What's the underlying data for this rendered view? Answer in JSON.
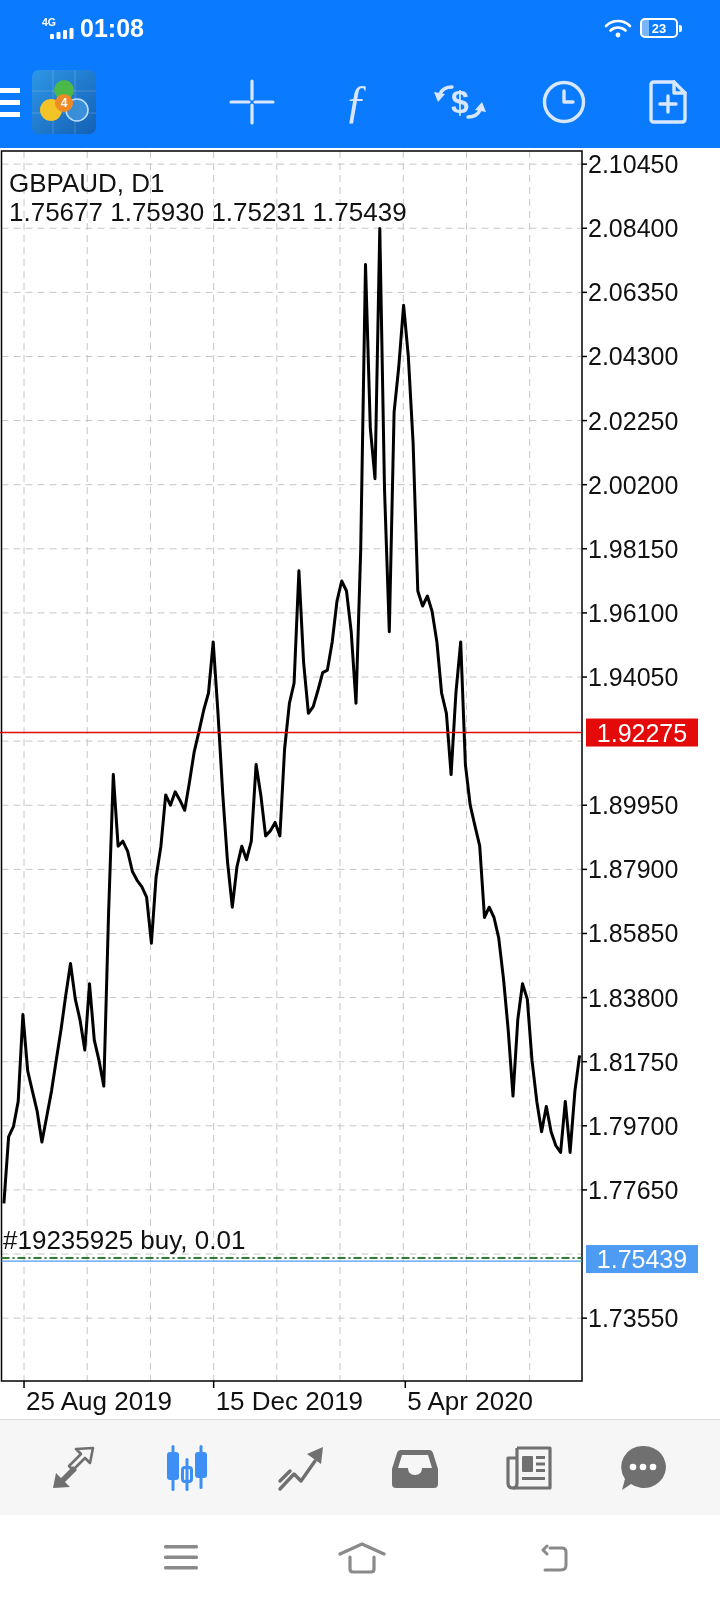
{
  "status_bar": {
    "network": "4G",
    "time": "01:08",
    "battery": "23"
  },
  "toolbar": {
    "logo_badge": "4",
    "items": [
      {
        "kind": "crosshair"
      },
      {
        "kind": "indicators",
        "glyph": "ƒ"
      },
      {
        "kind": "trade",
        "glyph": "$"
      },
      {
        "kind": "period"
      },
      {
        "kind": "objects"
      }
    ]
  },
  "chart": {
    "ohlc": "1.75677 1.75930 1.75231 1.75439",
    "chart_data": {
      "type": "line",
      "title": "GBPAUD, D1",
      "grid": true,
      "categories": [
        null,
        null,
        null,
        null,
        null,
        null,
        null,
        null,
        null,
        null,
        null,
        null,
        null,
        null,
        null,
        null,
        null,
        null,
        null,
        null,
        "25 Aug 2019",
        null,
        null,
        null,
        null,
        null,
        null,
        null,
        null,
        null,
        null,
        null,
        null,
        null,
        null,
        null,
        null,
        null,
        null,
        null,
        null,
        null,
        null,
        null,
        null,
        null,
        null,
        null,
        null,
        null,
        null,
        null,
        null,
        null,
        null,
        null,
        null,
        null,
        null,
        null,
        "15 Dec 2019",
        null,
        null,
        null,
        null,
        null,
        null,
        null,
        null,
        null,
        null,
        null,
        null,
        null,
        null,
        null,
        null,
        null,
        null,
        null,
        null,
        null,
        null,
        null,
        null,
        null,
        null,
        null,
        null,
        null,
        null,
        null,
        null,
        null,
        null,
        null,
        null,
        null,
        "5 Apr 2020",
        null,
        null,
        null,
        null,
        null,
        null,
        null,
        null,
        null,
        null,
        null,
        null,
        null,
        null,
        null,
        null,
        null,
        null,
        null,
        null,
        null,
        null,
        null
      ],
      "series": [
        {
          "color": "#000000",
          "values": [
            1.7722,
            1.7935,
            1.7967,
            1.8048,
            1.8326,
            1.8146,
            1.8081,
            1.8016,
            1.7918,
            1.7999,
            1.8081,
            1.8179,
            1.8277,
            1.8386,
            1.8489,
            1.8375,
            1.8309,
            1.8212,
            1.8424,
            1.8244,
            1.8179,
            1.8097,
            1.8652,
            1.9093,
            1.8864,
            1.888,
            1.8848,
            1.8783,
            1.8755,
            1.8734,
            1.8701,
            1.8554,
            1.8766,
            1.8864,
            1.9028,
            1.8995,
            1.9038,
            1.9011,
            1.8979,
            1.9068,
            1.9166,
            1.9231,
            1.9299,
            1.9354,
            1.9517,
            1.9289,
            1.9028,
            1.8815,
            1.8669,
            1.8799,
            1.8864,
            1.8821,
            1.888,
            1.9125,
            1.9028,
            1.8897,
            1.8913,
            1.894,
            1.8897,
            1.9175,
            1.9321,
            1.9386,
            1.9745,
            1.9452,
            1.9289,
            1.931,
            1.9362,
            1.9419,
            1.9427,
            1.9517,
            1.9648,
            1.9712,
            1.968,
            1.955,
            1.9321,
            1.9811,
            2.0724,
            2.0202,
            2.0039,
            2.0839,
            2.0007,
            1.955,
            2.0252,
            2.0398,
            2.0594,
            2.0431,
            2.0154,
            1.968,
            1.9632,
            1.9664,
            1.9615,
            1.9517,
            1.9354,
            1.9289,
            1.9093,
            1.9354,
            1.9517,
            1.9125,
            1.8995,
            1.893,
            1.8865,
            1.8636,
            1.8669,
            1.8636,
            1.8571,
            1.844,
            1.8277,
            1.8065,
            1.831,
            1.8424,
            1.8375,
            1.8179,
            1.8048,
            1.7951,
            1.8032,
            1.7951,
            1.7907,
            1.7885,
            1.8048,
            1.7885,
            1.8081,
            1.8195
          ]
        }
      ],
      "ylim": [
        1.7154,
        2.1087
      ],
      "yticks": [
        {
          "value": 2.1045,
          "label": "2.10450"
        },
        {
          "value": 2.084,
          "label": "2.08400"
        },
        {
          "value": 2.0635,
          "label": "2.06350"
        },
        {
          "value": 2.043,
          "label": "2.04300"
        },
        {
          "value": 2.0225,
          "label": "2.02250"
        },
        {
          "value": 2.002,
          "label": "2.00200"
        },
        {
          "value": 1.9815,
          "label": "1.98150"
        },
        {
          "value": 1.961,
          "label": "1.96100"
        },
        {
          "value": 1.9405,
          "label": "1.94050"
        },
        {
          "value": 1.8995,
          "label": "1.89950"
        },
        {
          "value": 1.879,
          "label": "1.87900"
        },
        {
          "value": 1.8585,
          "label": "1.85850"
        },
        {
          "value": 1.838,
          "label": "1.83800"
        },
        {
          "value": 1.8175,
          "label": "1.81750"
        },
        {
          "value": 1.797,
          "label": "1.79700"
        },
        {
          "value": 1.7765,
          "label": "1.77650"
        },
        {
          "value": 1.7355,
          "label": "1.73550"
        }
      ],
      "ref_lines": [
        {
          "axis": "y",
          "value": 1.92275,
          "label": "1.92275",
          "color": "#e40a0a"
        },
        {
          "axis": "y",
          "value": 1.75439,
          "color": "#2e7d32"
        },
        {
          "axis": "y",
          "value": 1.75439,
          "label": "1.75439",
          "color": "#4d9bf2"
        }
      ],
      "annotations": [
        "#19235925 buy, 0.01"
      ]
    }
  },
  "tabs": [
    {
      "kind": "quotes",
      "selected": false
    },
    {
      "kind": "chart",
      "selected": true
    },
    {
      "kind": "trade",
      "selected": false
    },
    {
      "kind": "history",
      "selected": false
    },
    {
      "kind": "news",
      "selected": false
    },
    {
      "kind": "messages",
      "selected": false
    }
  ]
}
